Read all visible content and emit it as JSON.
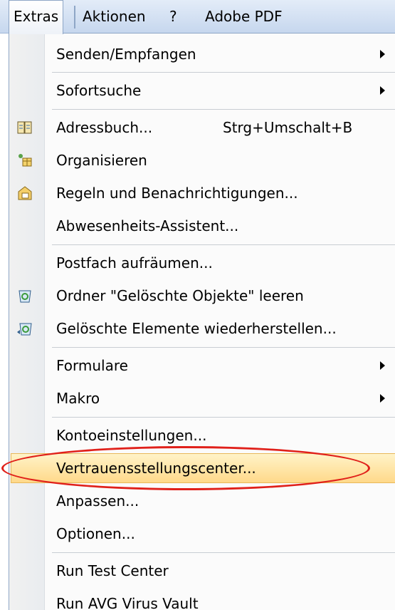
{
  "menubar": {
    "items": [
      {
        "label": "Extras",
        "active": true
      },
      {
        "label": "Aktionen"
      },
      {
        "label": "?"
      },
      {
        "label": "Adobe PDF"
      }
    ]
  },
  "menu": {
    "items": [
      {
        "label": "Senden/Empfangen",
        "submenu": true
      },
      {
        "label": "Sofortsuche",
        "submenu": true
      },
      {
        "label": "Adressbuch...",
        "shortcut": "Strg+Umschalt+B",
        "icon": "address-book-icon"
      },
      {
        "label": "Organisieren",
        "icon": "organize-icon"
      },
      {
        "label": "Regeln und Benachrichtigungen...",
        "icon": "rules-icon"
      },
      {
        "label": "Abwesenheits-Assistent..."
      },
      {
        "label": "Postfach aufräumen..."
      },
      {
        "label": "Ordner \"Gelöschte Objekte\" leeren",
        "icon": "empty-deleted-items-icon"
      },
      {
        "label": "Gelöschte Elemente wiederherstellen...",
        "icon": "recover-deleted-items-icon"
      },
      {
        "label": "Formulare",
        "submenu": true
      },
      {
        "label": "Makro",
        "submenu": true
      },
      {
        "label": "Kontoeinstellungen..."
      },
      {
        "label": "Vertrauensstellungscenter...",
        "highlighted": true
      },
      {
        "label": "Anpassen..."
      },
      {
        "label": "Optionen..."
      },
      {
        "label": "Run Test Center"
      },
      {
        "label": "Run AVG Virus Vault"
      }
    ]
  },
  "colors": {
    "highlight": "#ffd98a",
    "circle": "#e0201a",
    "menubar": "#c6d7ee"
  }
}
